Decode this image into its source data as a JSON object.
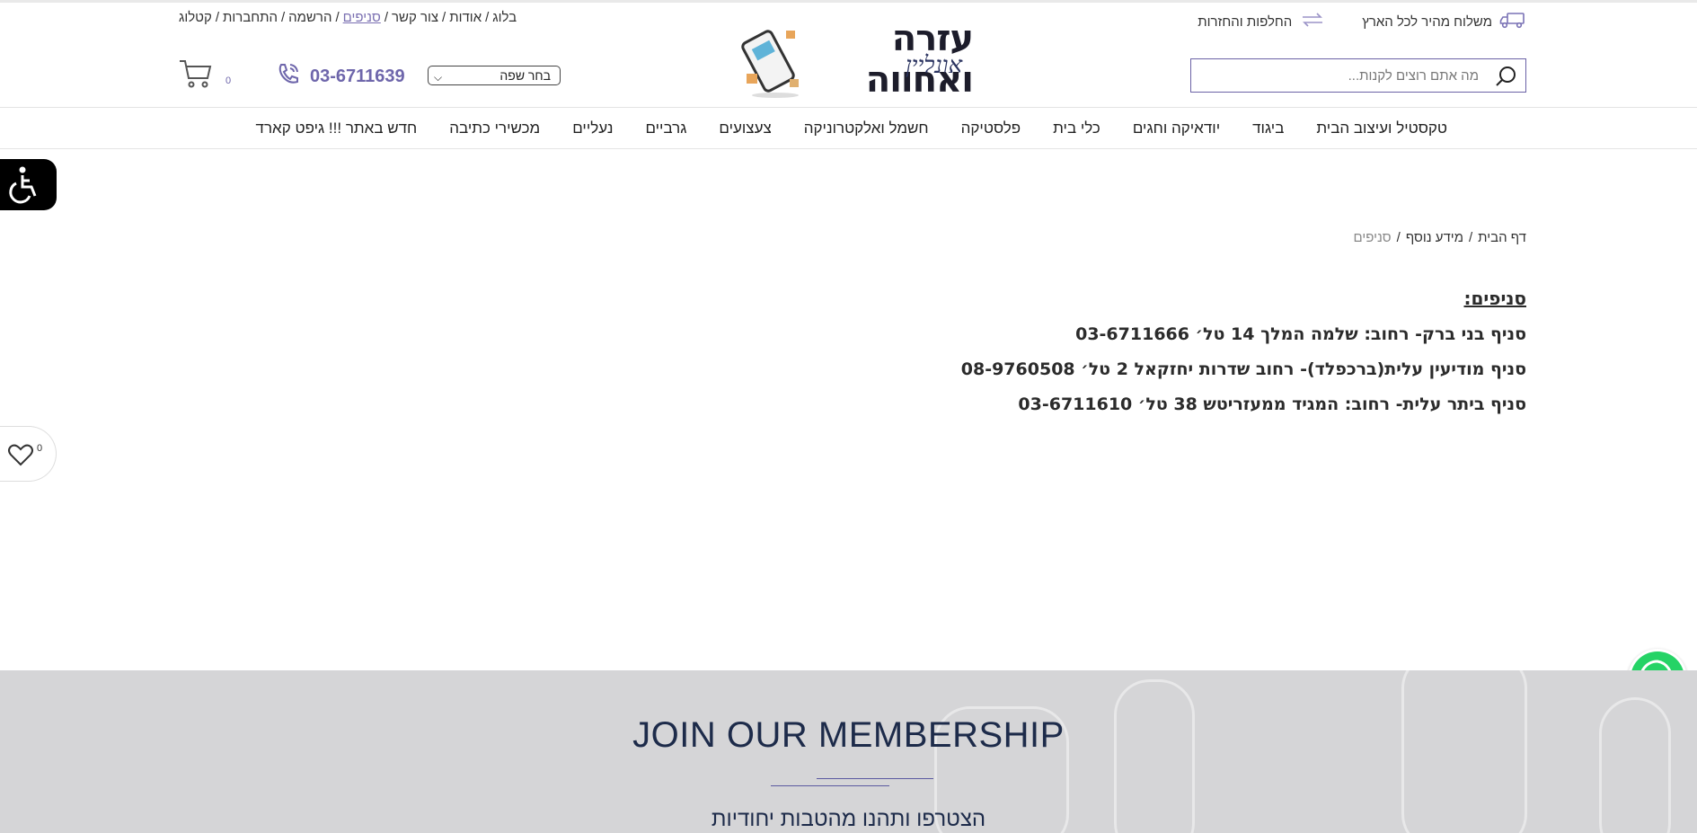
{
  "header": {
    "shipping": {
      "fast_shipping": "משלוח מהיר לכל הארץ",
      "exchanges": "החלפות והחזרות"
    },
    "top_links": [
      "בלוג",
      "אודות",
      "צור קשר",
      "סניפים",
      "הרשמה",
      "התחברות",
      "קטלוג"
    ],
    "active_link_index": 3,
    "logo": {
      "title": "עזרה ואחווה",
      "subtitle": "אונליין"
    },
    "search": {
      "placeholder": "מה אתם רוצים לקנות..."
    },
    "language": {
      "selected": "בחר שפה"
    },
    "phone": "03-6711639",
    "cart_count": "0",
    "accent_color": "#6e66ab"
  },
  "nav": {
    "items": [
      "טקסטיל ועיצוב הבית",
      "ביגוד",
      "יודאיקה וחגים",
      "כלי בית",
      "פלסטיקה",
      "חשמל ואלקטרוניקה",
      "צעצועים",
      "גרביים",
      "נעליים",
      "מכשירי כתיבה",
      "חדש באתר !!! גיפט קארד"
    ]
  },
  "breadcrumb": {
    "home": "דף הבית",
    "parent": "מידע נוסף",
    "current": "סניפים",
    "separator": "/"
  },
  "content": {
    "heading": "סניפים:",
    "branches": [
      "סניף בני ברק- רחוב: שלמה המלך 14 טל׳ 03-6711666",
      "סניף מודיעין עלית(ברכפלד)- רחוב שדרות יחזקאל 2 טל׳ 08-9760508",
      "סניף ביתר עלית- רחוב: המגיד ממעזריטש 38 טל׳ 03-6711610"
    ]
  },
  "wishlist": {
    "count": "0"
  },
  "membership": {
    "title": "JOIN OUR MEMBERSHIP",
    "subtitle": "הצטרפו ותהנו מהטבות יחודיות"
  },
  "icons": {
    "shipping": "truck-icon",
    "exchanges": "exchange-arrows-icon",
    "search": "search-icon",
    "phone": "phone-icon",
    "cart": "cart-icon",
    "accessibility": "wheelchair-icon",
    "wishlist": "heart-icon",
    "whatsapp": "whatsapp-icon"
  },
  "colors": {
    "whatsapp": "#25d366",
    "membership_bg": "#d5d5d7",
    "membership_text": "#1d2b4a"
  }
}
